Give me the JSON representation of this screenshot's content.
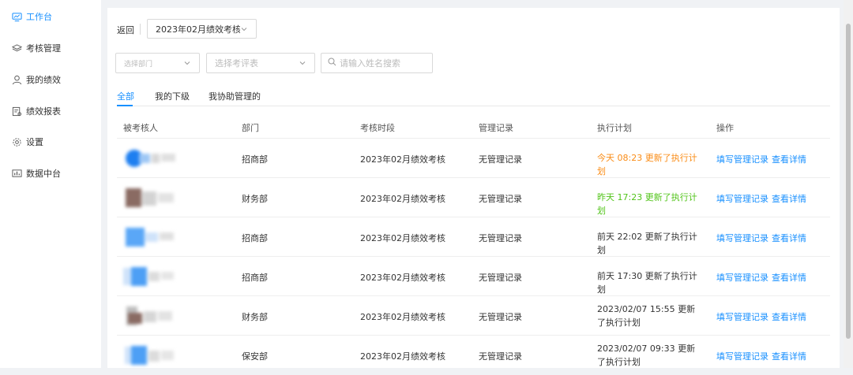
{
  "sidebar": {
    "items": [
      {
        "label": "工作台",
        "icon": "monitor-icon",
        "active": true
      },
      {
        "label": "考核管理",
        "icon": "layers-icon",
        "active": false
      },
      {
        "label": "我的绩效",
        "icon": "user-icon",
        "active": false
      },
      {
        "label": "绩效报表",
        "icon": "report-icon",
        "active": false
      },
      {
        "label": "设置",
        "icon": "gear-icon",
        "active": false
      },
      {
        "label": "数据中台",
        "icon": "chart-icon",
        "active": false
      }
    ]
  },
  "header": {
    "back_label": "返回",
    "period_select": "2023年02月绩效考核"
  },
  "filters": {
    "department_placeholder": "选择部门",
    "evaluation_placeholder": "选择考评表",
    "search_placeholder": "请输入姓名搜索"
  },
  "tabs": [
    {
      "label": "全部",
      "active": true
    },
    {
      "label": "我的下级",
      "active": false
    },
    {
      "label": "我协助管理的",
      "active": false
    }
  ],
  "table": {
    "columns": [
      "被考核人",
      "部门",
      "考核时段",
      "管理记录",
      "执行计划",
      "操作"
    ],
    "rows": [
      {
        "department": "招商部",
        "period": "2023年02月绩效考核",
        "record": "无管理记录",
        "plan": "今天 08:23 更新了执行计划",
        "plan_color": "#fa8c16",
        "action1": "填写管理记录",
        "action2": "查看详情"
      },
      {
        "department": "财务部",
        "period": "2023年02月绩效考核",
        "record": "无管理记录",
        "plan": "昨天 17:23 更新了执行计划",
        "plan_color": "#52c41a",
        "action1": "填写管理记录",
        "action2": "查看详情"
      },
      {
        "department": "招商部",
        "period": "2023年02月绩效考核",
        "record": "无管理记录",
        "plan": "前天 22:02 更新了执行计划",
        "plan_color": "#333333",
        "action1": "填写管理记录",
        "action2": "查看详情"
      },
      {
        "department": "招商部",
        "period": "2023年02月绩效考核",
        "record": "无管理记录",
        "plan": "前天 17:30 更新了执行计划",
        "plan_color": "#333333",
        "action1": "填写管理记录",
        "action2": "查看详情"
      },
      {
        "department": "财务部",
        "period": "2023年02月绩效考核",
        "record": "无管理记录",
        "plan": "2023/02/07 15:55 更新了执行计划",
        "plan_color": "#333333",
        "action1": "填写管理记录",
        "action2": "查看详情"
      },
      {
        "department": "保安部",
        "period": "2023年02月绩效考核",
        "record": "无管理记录",
        "plan": "2023/02/07 09:33 更新了执行计划",
        "plan_color": "#333333",
        "action1": "填写管理记录",
        "action2": "查看详情"
      }
    ]
  },
  "colors": {
    "accent": "#1890ff",
    "today": "#fa8c16",
    "yesterday": "#52c41a"
  }
}
